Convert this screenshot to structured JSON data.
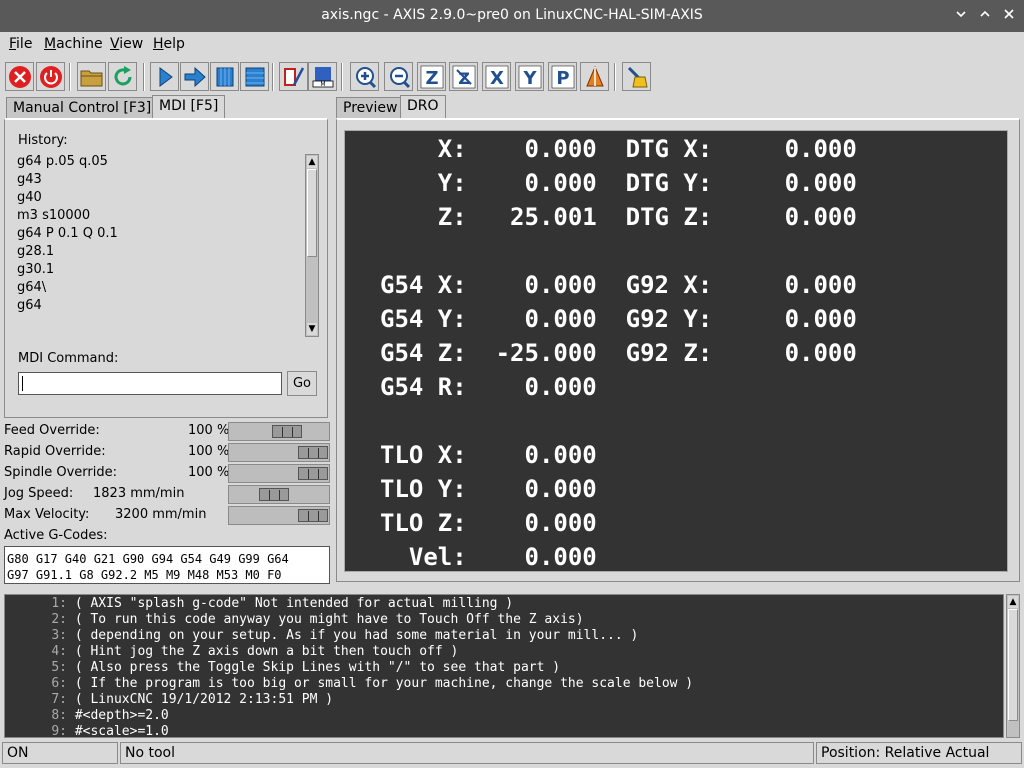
{
  "window": {
    "title": "axis.ngc - AXIS 2.9.0~pre0 on LinuxCNC-HAL-SIM-AXIS",
    "buttons": [
      "﹀",
      "⌃",
      "✕"
    ]
  },
  "menu": {
    "items": [
      {
        "underline": "F",
        "rest": "ile"
      },
      {
        "underline": "M",
        "rest": "achine"
      },
      {
        "underline": "V",
        "rest": "iew"
      },
      {
        "underline": "H",
        "rest": "elp"
      }
    ]
  },
  "toolbar": {
    "icons": [
      "estop-icon",
      "power-icon",
      "open-file-icon",
      "reload-icon",
      "run-icon",
      "step-icon",
      "pause-icon",
      "stop-icon",
      "touch-off-icon",
      "mist-icon",
      "zoom-in-icon",
      "zoom-out-icon",
      "view-z-icon",
      "view-z2-icon",
      "view-x-icon",
      "view-y-icon",
      "view-p-icon",
      "rotate-icon",
      "clear-plot-icon"
    ],
    "z_letter": "Z",
    "x_letter": "X",
    "y_letter": "Y",
    "p_letter": "P",
    "mdi_letters": "M"
  },
  "left_tabs": {
    "manual": "Manual Control [F3]",
    "mdi": "MDI [F5]"
  },
  "right_tabs": {
    "preview": "Preview",
    "dro": "DRO"
  },
  "mdi": {
    "history_label": "History:",
    "history": [
      "g64 p.05 q.05",
      "g43",
      "g40",
      "m3 s10000",
      "g64 P 0.1 Q 0.1",
      "g28.1",
      "g30.1",
      "g64\\",
      "g64"
    ],
    "command_label": "MDI Command:",
    "command_value": "",
    "go_label": "Go"
  },
  "overrides": {
    "feed": {
      "label": "Feed Override:",
      "value": "100 %",
      "level": 0.62
    },
    "rapid": {
      "label": "Rapid Override:",
      "value": "100 %",
      "level": 1.0
    },
    "spindle": {
      "label": "Spindle Override:",
      "value": "100 %",
      "level": 1.0
    },
    "jog": {
      "label": "Jog Speed:",
      "value": "1823 mm/min",
      "level": 0.42
    },
    "maxvel": {
      "label": "Max Velocity:",
      "value": "3200 mm/min",
      "level": 1.0
    }
  },
  "gcodes": {
    "label": "Active G-Codes:",
    "line1": "G80 G17 G40 G21 G90 G94 G54 G49 G99 G64",
    "line2": "G97 G91.1 G8 G92.2 M5 M9 M48 M53 M0 F0"
  },
  "dro": {
    "lines": [
      "    X:    0.000  DTG X:     0.000",
      "    Y:    0.000  DTG Y:     0.000",
      "    Z:   25.001  DTG Z:     0.000",
      "",
      "G54 X:    0.000  G92 X:     0.000",
      "G54 Y:    0.000  G92 Y:     0.000",
      "G54 Z:  -25.000  G92 Z:     0.000",
      "G54 R:    0.000",
      "",
      "TLO X:    0.000",
      "TLO Y:    0.000",
      "TLO Z:    0.000",
      "  Vel:    0.000"
    ]
  },
  "code": {
    "lines": [
      {
        "n": "1:",
        "t": "( AXIS \"splash g-code\" Not intended for actual milling )"
      },
      {
        "n": "2:",
        "t": "( To run this code anyway you might have to Touch Off the Z axis)"
      },
      {
        "n": "3:",
        "t": "( depending on your setup. As if you had some material in your mill... )"
      },
      {
        "n": "4:",
        "t": "( Hint jog the Z axis down a bit then touch off )"
      },
      {
        "n": "5:",
        "t": "( Also press the Toggle Skip Lines with \"/\" to see that part )"
      },
      {
        "n": "6:",
        "t": "( If the program is too big or small for your machine, change the scale below )"
      },
      {
        "n": "7:",
        "t": "( LinuxCNC 19/1/2012 2:13:51 PM )"
      },
      {
        "n": "8:",
        "t": "#<depth>=2.0"
      },
      {
        "n": "9:",
        "t": "#<scale>=1.0"
      }
    ]
  },
  "status": {
    "state": "ON",
    "tool": "No tool",
    "position": "Position: Relative Actual"
  }
}
